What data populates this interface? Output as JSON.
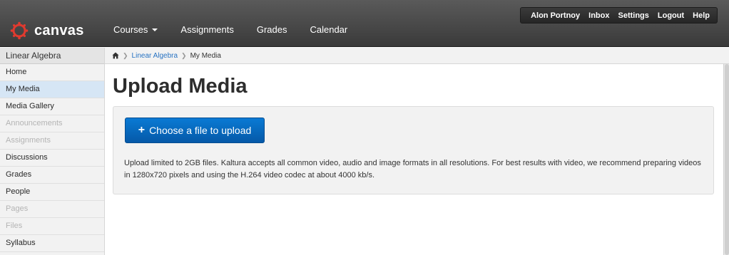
{
  "header": {
    "logo_text": "canvas",
    "identity": {
      "user": "Alon Portnoy",
      "inbox": "Inbox",
      "settings": "Settings",
      "logout": "Logout",
      "help": "Help"
    },
    "menu": {
      "courses": "Courses",
      "assignments": "Assignments",
      "grades": "Grades",
      "calendar": "Calendar"
    },
    "colors": {
      "logo_red": "#e03a2f",
      "header_bg": "#4a4a4a"
    }
  },
  "sidebar": {
    "course_title": "Linear Algebra",
    "items": [
      {
        "label": "Home",
        "state": "normal"
      },
      {
        "label": "My Media",
        "state": "active"
      },
      {
        "label": "Media Gallery",
        "state": "normal"
      },
      {
        "label": "Announcements",
        "state": "disabled"
      },
      {
        "label": "Assignments",
        "state": "disabled"
      },
      {
        "label": "Discussions",
        "state": "normal"
      },
      {
        "label": "Grades",
        "state": "normal"
      },
      {
        "label": "People",
        "state": "normal"
      },
      {
        "label": "Pages",
        "state": "disabled"
      },
      {
        "label": "Files",
        "state": "disabled"
      },
      {
        "label": "Syllabus",
        "state": "normal"
      }
    ]
  },
  "breadcrumb": {
    "home_icon": "home-icon",
    "course": "Linear Algebra",
    "current": "My Media"
  },
  "main": {
    "title": "Upload Media",
    "upload_button": "Choose a file to upload",
    "upload_button_icon": "+",
    "note": "Upload limited to 2GB files. Kaltura accepts all common video, audio and image formats in all resolutions. For best results with video, we recommend preparing videos in 1280x720 pixels and using the H.264 video codec at about 4000 kb/s.",
    "colors": {
      "button_blue": "#0a6ec4",
      "link_blue": "#2873c2"
    }
  }
}
